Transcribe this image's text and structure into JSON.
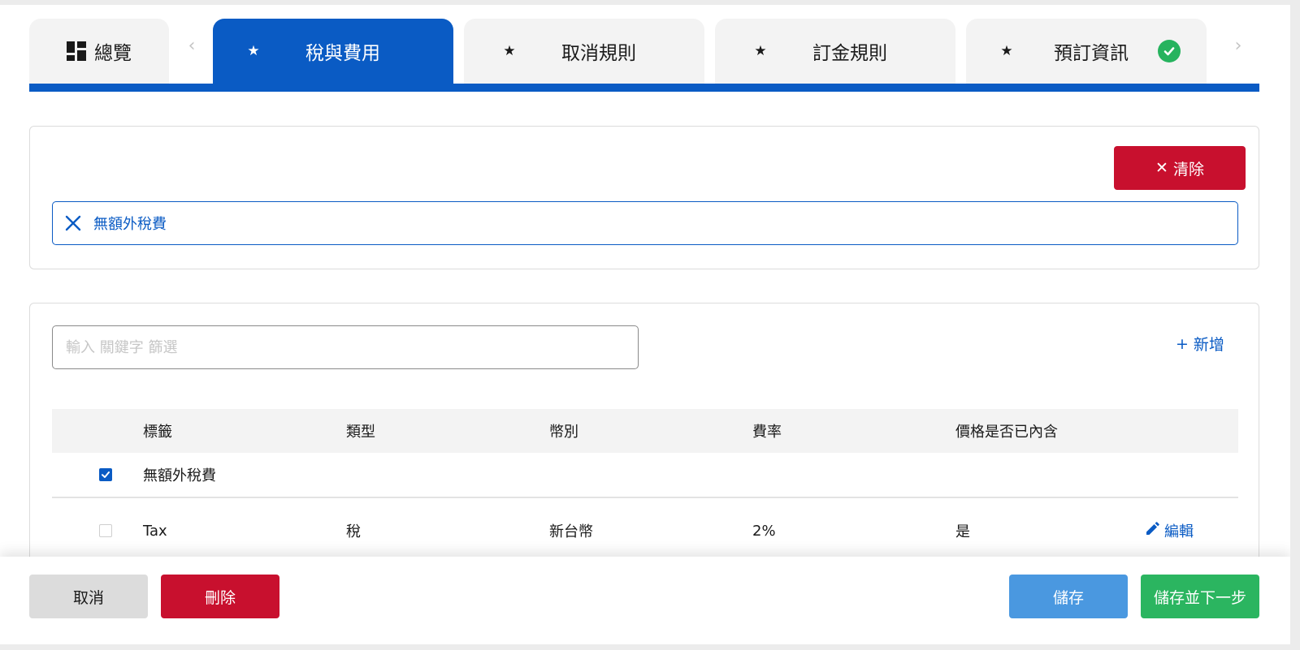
{
  "tabs": {
    "overview": "總覽",
    "tax_fees": "稅與費用",
    "cancellation": "取消規則",
    "deposit": "訂金規則",
    "booking_info": "預訂資訊",
    "star_glyph": "★",
    "prev_arrow": "‹",
    "next_arrow": "›",
    "icons": {
      "overview": "dashboard-grid-icon",
      "complete": "check-circle-icon",
      "required": "star-icon"
    }
  },
  "filter": {
    "clear_label": "清除",
    "clear_glyph": "✕",
    "chip_label": "無額外稅費"
  },
  "table": {
    "search_placeholder": "輸入 關鍵字 篩選",
    "add_label": "新增",
    "add_glyph": "+",
    "headers": [
      "標籤",
      "類型",
      "幣別",
      "費率",
      "價格是否已內含"
    ],
    "group_row": {
      "label": "無額外稅費",
      "checked": true
    },
    "rows": [
      {
        "label": "Tax",
        "type": "稅",
        "currency": "新台幣",
        "rate": "2%",
        "included": "是",
        "checked": false,
        "edit_label": "編輯"
      }
    ]
  },
  "footer": {
    "cancel": "取消",
    "delete": "刪除",
    "save": "儲存",
    "save_next": "儲存並下一步"
  },
  "colors": {
    "primary": "#0a5bc4",
    "danger": "#c8102e",
    "save": "#4a98e0",
    "success": "#2bb560",
    "check": "#26b35e"
  }
}
